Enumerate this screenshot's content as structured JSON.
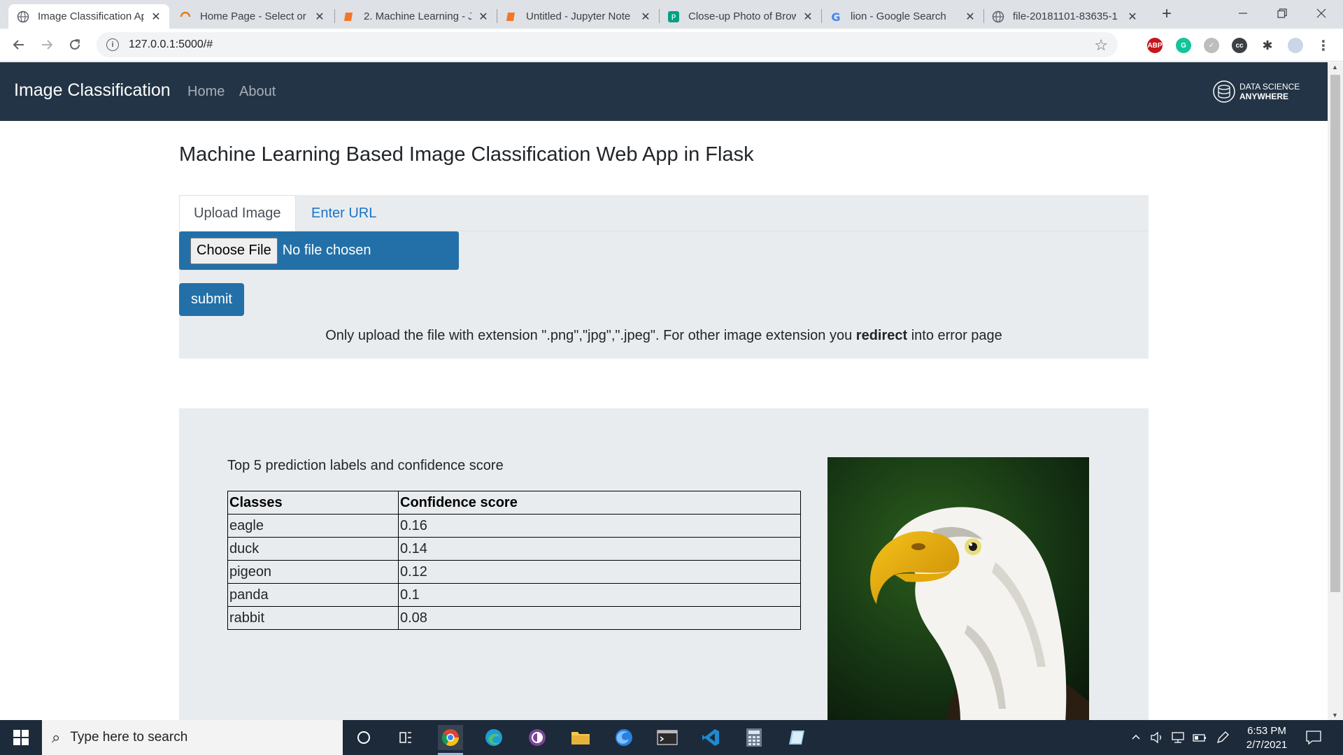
{
  "browser": {
    "tabs": [
      {
        "title": "Image Classification Ap",
        "active": true
      },
      {
        "title": "Home Page - Select or",
        "active": false
      },
      {
        "title": "2. Machine Learning - J",
        "active": false
      },
      {
        "title": "Untitled - Jupyter Note",
        "active": false
      },
      {
        "title": "Close-up Photo of Brow",
        "active": false
      },
      {
        "title": "lion - Google Search",
        "active": false
      },
      {
        "title": "file-20181101-83635-1",
        "active": false
      }
    ],
    "url": "127.0.0.1:5000/#",
    "extensions": {
      "abp": "ABP"
    }
  },
  "navbar": {
    "brand": "Image Classification",
    "links": [
      "Home",
      "About"
    ],
    "logo_line1": "DATA SCIENCE",
    "logo_line2": "ANYWHERE"
  },
  "main": {
    "heading": "Machine Learning Based Image Classification Web App in Flask",
    "tabs": [
      {
        "label": "Upload Image",
        "active": true
      },
      {
        "label": "Enter URL",
        "active": false
      }
    ],
    "file_button": "Choose File",
    "file_status": "No file chosen",
    "submit_label": "submit",
    "note_before": "Only upload the file with extension \".png\",\"jpg\",\".jpeg\". For other image extension you ",
    "note_bold": "redirect",
    "note_after": " into error page"
  },
  "results": {
    "title": "Top 5 prediction labels and confidence score",
    "columns": [
      "Classes",
      "Confidence score"
    ],
    "rows": [
      {
        "class": "eagle",
        "score": "0.16"
      },
      {
        "class": "duck",
        "score": "0.14"
      },
      {
        "class": "pigeon",
        "score": "0.12"
      },
      {
        "class": "panda",
        "score": "0.1"
      },
      {
        "class": "rabbit",
        "score": "0.08"
      }
    ]
  },
  "taskbar": {
    "search_placeholder": "Type here to search",
    "time": "6:53 PM",
    "date": "2/7/2021"
  },
  "colors": {
    "navbar": "#233446",
    "primary": "#2370a8",
    "panel": "#e9ecef",
    "link": "#1a73c8"
  }
}
